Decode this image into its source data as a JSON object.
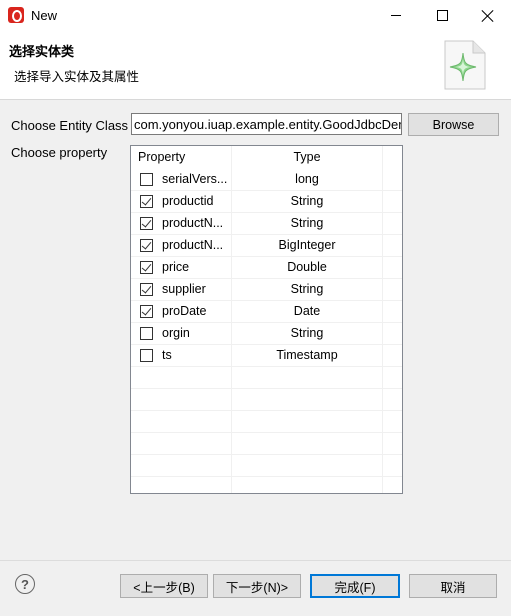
{
  "window": {
    "title": "New"
  },
  "banner": {
    "title": "选择实体类",
    "description": "选择导入实体及其属性"
  },
  "form": {
    "entity_class_label": "Choose Entity Class",
    "entity_class_value": "com.yonyou.iuap.example.entity.GoodJdbcDemo",
    "browse_label": "Browse",
    "property_label": "Choose property"
  },
  "table": {
    "headers": [
      "Property",
      "Type"
    ],
    "rows": [
      {
        "name": "serialVers...",
        "type": "long",
        "checked": false
      },
      {
        "name": "productid",
        "type": "String",
        "checked": true
      },
      {
        "name": "productN...",
        "type": "String",
        "checked": true
      },
      {
        "name": "productN...",
        "type": "BigInteger",
        "checked": true
      },
      {
        "name": "price",
        "type": "Double",
        "checked": true
      },
      {
        "name": "supplier",
        "type": "String",
        "checked": true
      },
      {
        "name": "proDate",
        "type": "Date",
        "checked": true
      },
      {
        "name": "orgin",
        "type": "String",
        "checked": false
      },
      {
        "name": "ts",
        "type": "Timestamp",
        "checked": false
      }
    ]
  },
  "buttons": {
    "back": "<上一步(B)",
    "next": "下一步(N)>",
    "finish": "完成(F)",
    "cancel": "取消"
  },
  "help": {
    "glyph": "?"
  },
  "icons": {
    "app": "eclipse-app-icon",
    "banner": "wizard-sparkle-icon",
    "help": "help-icon"
  }
}
